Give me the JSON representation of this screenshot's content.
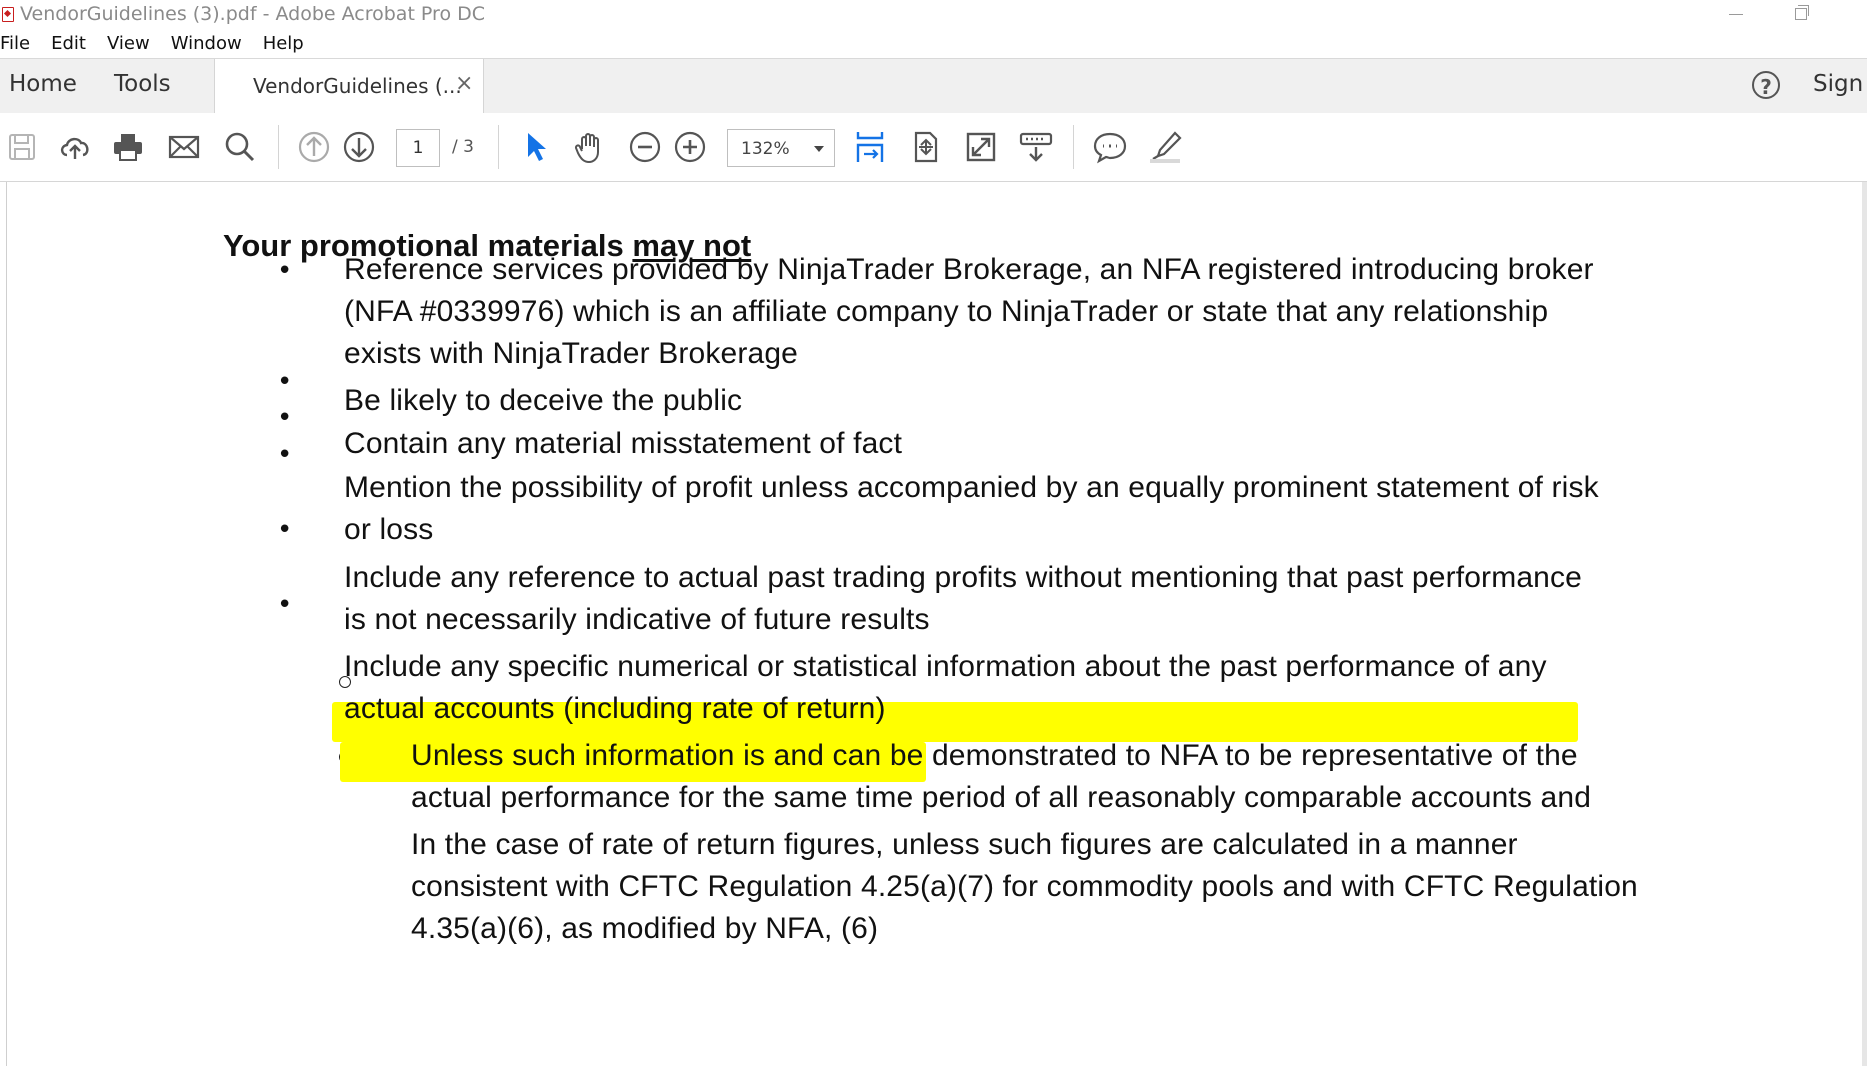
{
  "window": {
    "title": "VendorGuidelines (3).pdf - Adobe Acrobat Pro DC"
  },
  "menu": [
    "File",
    "Edit",
    "View",
    "Window",
    "Help"
  ],
  "tabs": {
    "home": "Home",
    "tools": "Tools",
    "document": "VendorGuidelines (...",
    "close_glyph": "×",
    "sign": "Sign",
    "help_glyph": "?"
  },
  "toolbar": {
    "current_page": "1",
    "page_total": "/ 3",
    "zoom": "132%"
  },
  "document": {
    "heading_prefix": "Your promotional materials ",
    "heading_underlined": "may not",
    "lines": [
      "Reference services provided by NinjaTrader Brokerage, an NFA registered introducing broker",
      "(NFA #0339976) which is an affiliate company to NinjaTrader or state that any relationship",
      "exists with NinjaTrader Brokerage",
      "Be likely to deceive the public",
      "Contain any material misstatement of fact",
      "Mention the possibility of profit unless accompanied by an equally prominent statement of risk",
      "or loss",
      "Include any reference to actual past trading profits without mentioning that past performance",
      "is not necessarily indicative of future results",
      "Include any specific numerical or statistical information about the past performance of any",
      "actual accounts (including rate of return)",
      "Unless such information is and can be demonstrated to NFA to be representative of the",
      "actual performance for the same time period of all reasonably comparable accounts and",
      "In the case of rate of return figures, unless such figures are calculated in a manner",
      "consistent with CFTC Regulation 4.25(a)(7) for commodity pools and with CFTC Regulation",
      "4.35(a)(6), as modified by NFA, (6)"
    ],
    "bullet_glyph": "•"
  },
  "colors": {
    "highlight": "#ffff00",
    "accent_blue": "#1473e6",
    "acrobat_red": "#c81e1e"
  },
  "icons": [
    "save-icon",
    "upload-icon",
    "print-icon",
    "email-icon",
    "search-icon",
    "prev-page-icon",
    "next-page-icon",
    "select-arrow-icon",
    "hand-icon",
    "zoom-out-icon",
    "zoom-in-icon",
    "scroll-mode-icon",
    "rotate-icon",
    "fullscreen-icon",
    "read-mode-icon",
    "comment-icon",
    "highlight-pen-icon"
  ]
}
